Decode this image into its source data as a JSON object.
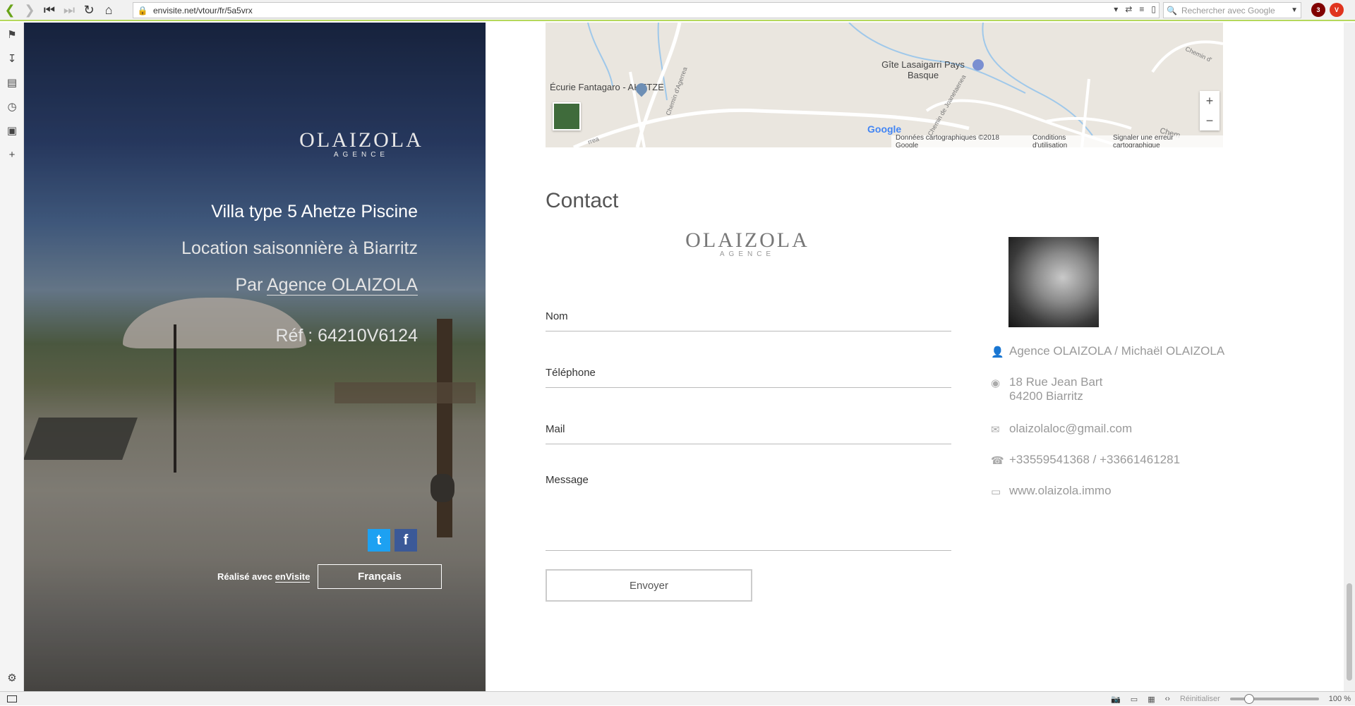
{
  "browser": {
    "url": "envisite.net/vtour/fr/5a5vrx",
    "search_placeholder": "Rechercher avec Google",
    "ublock_count": "3",
    "status": {
      "reset_label": "Réinitialiser",
      "zoom": "100 %"
    }
  },
  "hero": {
    "logo_main": "OLAIZOLA",
    "logo_sub": "AGENCE",
    "title": "Villa type 5 Ahetze Piscine",
    "subtitle": "Location saisonnière à Biarritz",
    "by_prefix": "Par",
    "agency_link": "Agence OLAIZOLA",
    "ref": "Réf : 64210V6124",
    "social": {
      "twitter": "t",
      "facebook": "f"
    },
    "made_by_prefix": "Réalisé avec",
    "made_by_link": "enVisite",
    "language_button": "Français"
  },
  "map": {
    "labels": {
      "ecurie": "Écurie Fantagaro - AHETZE",
      "gite": "Gîte Lasaigarri Pays Basque",
      "chemin_agerrea": "Chemin d'Agerrea",
      "chemin_joanetaenea": "Chemin de Joanetaenea",
      "chemin": "Chemin d'",
      "chem": "Chem",
      "rea": "rrea"
    },
    "google": "Google",
    "footer": {
      "data": "Données cartographiques ©2018 Google",
      "terms": "Conditions d'utilisation",
      "report": "Signaler une erreur cartographique"
    },
    "zoom_in": "+",
    "zoom_out": "−"
  },
  "contact": {
    "title": "Contact",
    "logo_main": "OLAIZOLA",
    "logo_sub": "AGENCE",
    "fields": {
      "name": "Nom",
      "phone": "Téléphone",
      "mail": "Mail",
      "message": "Message"
    },
    "send": "Envoyer",
    "agent": "Agence OLAIZOLA / Michaël OLAIZOLA",
    "address_line1": "18 Rue Jean Bart",
    "address_line2": "64200 Biarritz",
    "email": "olaizolaloc@gmail.com",
    "phones": "+33559541368 / +33661461281",
    "website": "www.olaizola.immo"
  }
}
